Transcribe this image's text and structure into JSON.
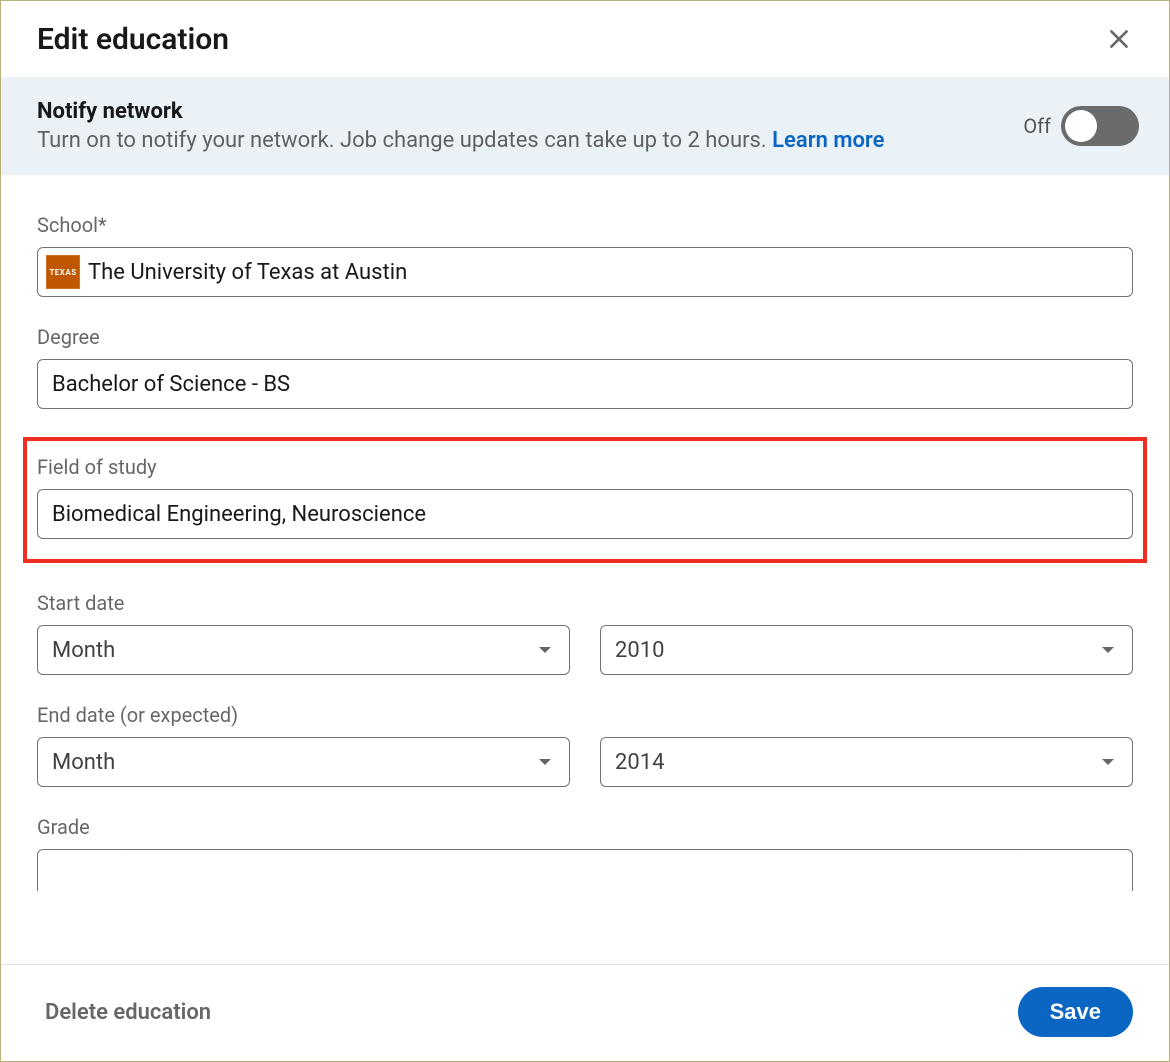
{
  "modal": {
    "title": "Edit education"
  },
  "notify": {
    "title": "Notify network",
    "description_prefix": "Turn on to notify your network. Job change updates can take up to 2 hours. ",
    "learn_more": "Learn more",
    "toggle_state_label": "Off",
    "toggle_on": false
  },
  "fields": {
    "school": {
      "label": "School*",
      "value": "The University of Texas at Austin",
      "logo_text": "TEXAS"
    },
    "degree": {
      "label": "Degree",
      "value": "Bachelor of Science - BS"
    },
    "field_of_study": {
      "label": "Field of study",
      "value": "Biomedical Engineering, Neuroscience",
      "highlighted": true
    },
    "start_date": {
      "label": "Start date",
      "month": {
        "placeholder": "Month",
        "value": ""
      },
      "year": {
        "value": "2010"
      }
    },
    "end_date": {
      "label": "End date (or expected)",
      "month": {
        "placeholder": "Month",
        "value": ""
      },
      "year": {
        "value": "2014"
      }
    },
    "grade": {
      "label": "Grade",
      "value": ""
    }
  },
  "footer": {
    "delete_label": "Delete education",
    "save_label": "Save"
  }
}
